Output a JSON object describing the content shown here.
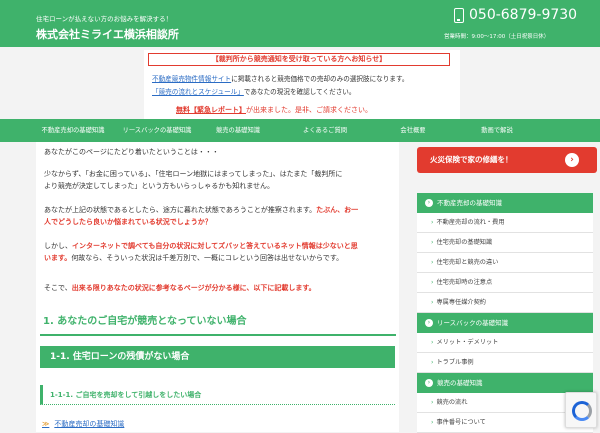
{
  "header": {
    "tagline": "住宅ローンが払えない方のお悩みを解決する！",
    "company": "株式会社ミライエ横浜相談所",
    "phone": "050-6879-9730",
    "hours": "営業時間：9:00〜17:00（土日祝祭日休）"
  },
  "notice": {
    "title": "【裁判所から競売通知を受け取っている方へお知らせ】",
    "line1_link": "不動産競売物件情報サイト",
    "line1_text": "に掲載されると競売価格での売却のみの選択肢になります。",
    "line2_link": "「競売の流れとスケジュール」",
    "line2_text": "であなたの現況を確認してください。",
    "red_link": "無料【緊急レポート】",
    "red_text": "が出来ました。是非、ご請求ください。"
  },
  "nav": {
    "items": [
      "不動産売却の基礎知識",
      "リースバックの基礎知識",
      "競売の基礎知識",
      "よくあるご質問",
      "会社概要",
      "動画で解説"
    ]
  },
  "main": {
    "p1": "あなたがこのページにたどり着いたということは・・・",
    "p2a": "少なからず、「お金に困っている」、「住宅ローン地獄にはまってしまった」、はたまた「裁判所に",
    "p2b": "より競売が決定してしまった」という方もいらっしゃるかも知れません。",
    "p3a": "あなたが上記の状態であるとしたら、途方に暮れた状態であろうことが推察されます。",
    "p3a_red": "たぶん、お一",
    "p3b_red": "人でどうしたら良いか悩まれている状況でしょうか？",
    "p4a": "しかし、",
    "p4a_red": "インターネットで調べても自分の状況に対してズバッと答えているネット情報は少ないと思",
    "p4b_red": "います。",
    "p4b": "何故なら、そういった状況は千差万別で、一概にコレという回答は出せないからです。",
    "p5a": "そこで、",
    "p5a_red": "出来る限りあなたの状況に参考なるページが分かる様に、以下に記載します。",
    "h2": "1. あなたのご自宅が競売となっていない場合",
    "h3": "1-1. 住宅ローンの残債がない場合",
    "h4": "1-1-1. ご自宅を売却をして引越しをしたい場合",
    "link": "不動産売却の基礎知識"
  },
  "side": {
    "cta": "火災保険で家の修繕を！",
    "sections": [
      {
        "title": "不動産売却の基礎知識",
        "items": [
          "不動産売却の流れ・費用",
          "住宅売却の基礎知識",
          "住宅売却と競売の違い",
          "住宅売却時の注意点",
          "専属専任媒介契約"
        ]
      },
      {
        "title": "リースバックの基礎知識",
        "items": [
          "メリット・デメリット",
          "トラブル事例"
        ]
      },
      {
        "title": "競売の基礎知識",
        "items": [
          "競売の流れ",
          "事件番号について"
        ]
      }
    ]
  },
  "colors": {
    "brand_green": "#3fb26b",
    "alert_red": "#e23b2f",
    "link_blue": "#2b6cc4"
  },
  "icons": {
    "phone": "phone-icon",
    "cta_arrow": "arrow-right-icon",
    "link_arrow": "double-arrow-icon",
    "recaptcha": "recaptcha-icon"
  }
}
